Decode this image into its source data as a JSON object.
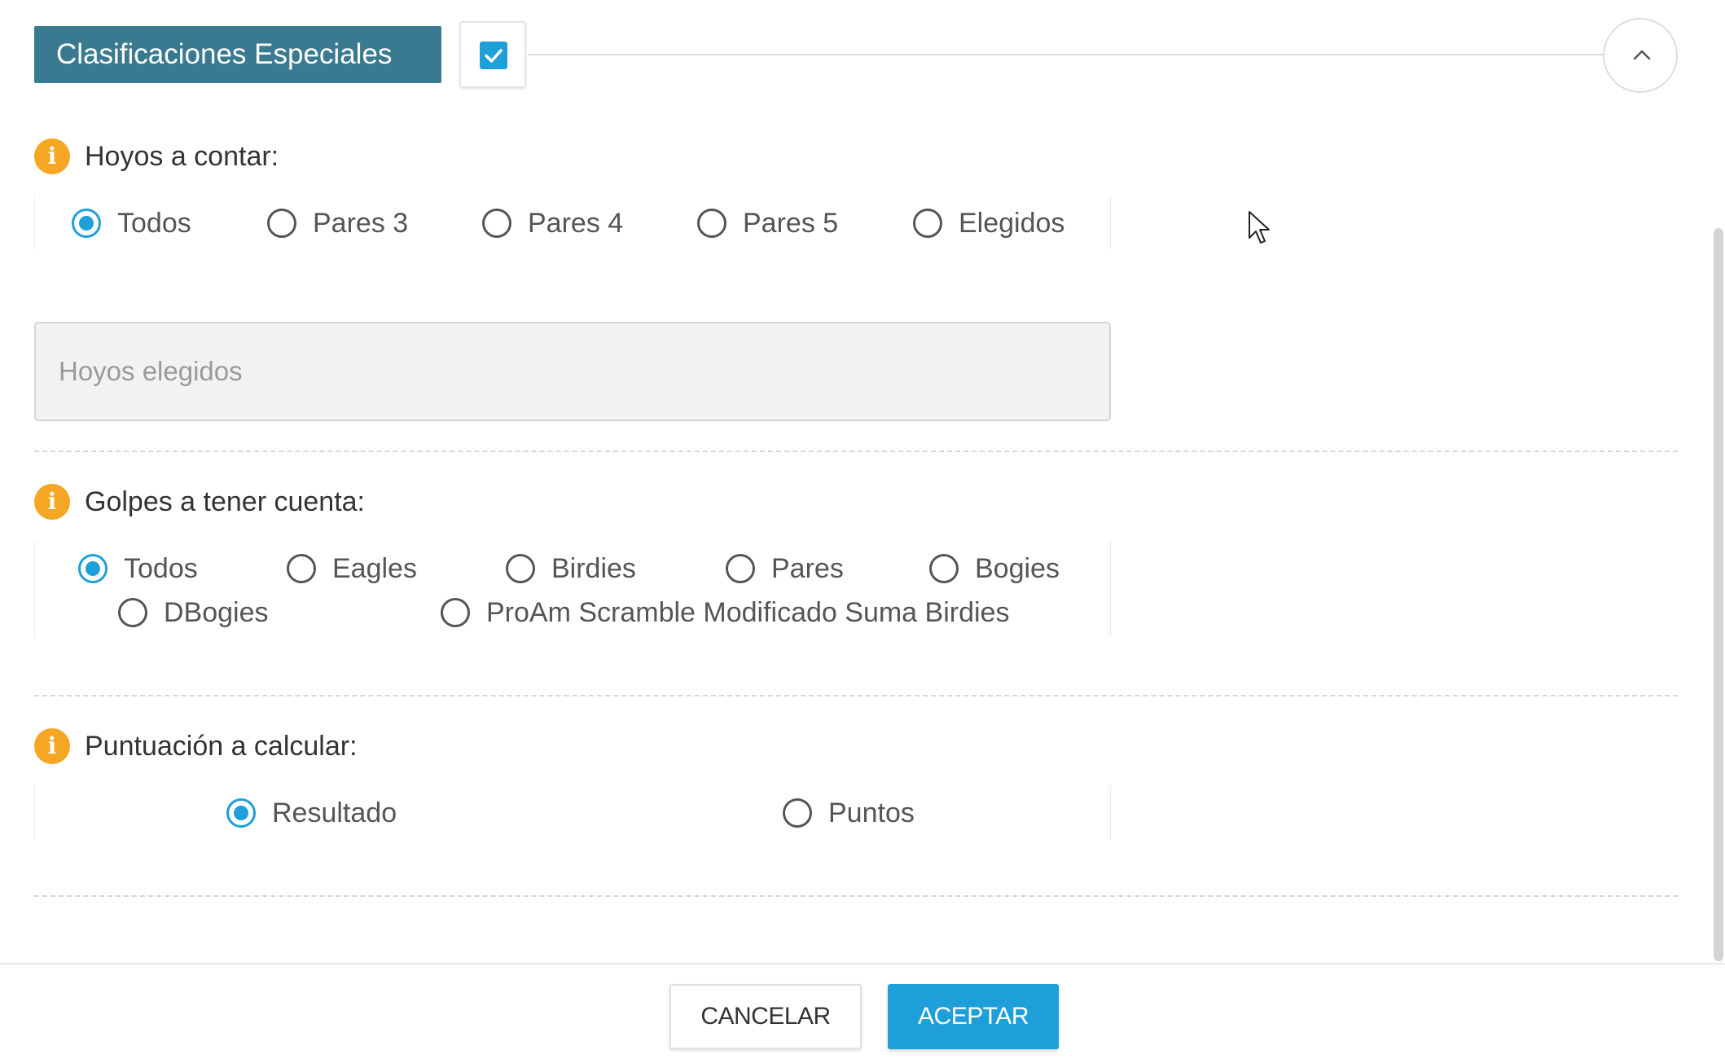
{
  "header": {
    "title": "Clasificaciones Especiales",
    "enabled_checked": true,
    "collapse_icon": "chevron-up-icon"
  },
  "holes": {
    "label": "Hoyos a contar:",
    "info_icon": "i",
    "options": [
      {
        "label": "Todos",
        "checked": true
      },
      {
        "label": "Pares 3",
        "checked": false
      },
      {
        "label": "Pares 4",
        "checked": false
      },
      {
        "label": "Pares 5",
        "checked": false
      },
      {
        "label": "Elegidos",
        "checked": false
      }
    ],
    "chosen_placeholder": "Hoyos elegidos",
    "chosen_value": ""
  },
  "strokes": {
    "label": "Golpes a tener cuenta:",
    "info_icon": "i",
    "options": [
      {
        "label": "Todos",
        "checked": true
      },
      {
        "label": "Eagles",
        "checked": false
      },
      {
        "label": "Birdies",
        "checked": false
      },
      {
        "label": "Pares",
        "checked": false
      },
      {
        "label": "Bogies",
        "checked": false
      },
      {
        "label": "DBogies",
        "checked": false
      },
      {
        "label": "ProAm Scramble Modificado Suma Birdies",
        "checked": false
      }
    ]
  },
  "scoring": {
    "label": "Puntuación a calcular:",
    "info_icon": "i",
    "options": [
      {
        "label": "Resultado",
        "checked": true
      },
      {
        "label": "Puntos",
        "checked": false
      }
    ]
  },
  "footer": {
    "cancel_label": "CANCELAR",
    "accept_label": "ACEPTAR"
  },
  "colors": {
    "accent": "#1f9fd9",
    "title_bg": "#3a7a90",
    "info": "#f5a623"
  }
}
